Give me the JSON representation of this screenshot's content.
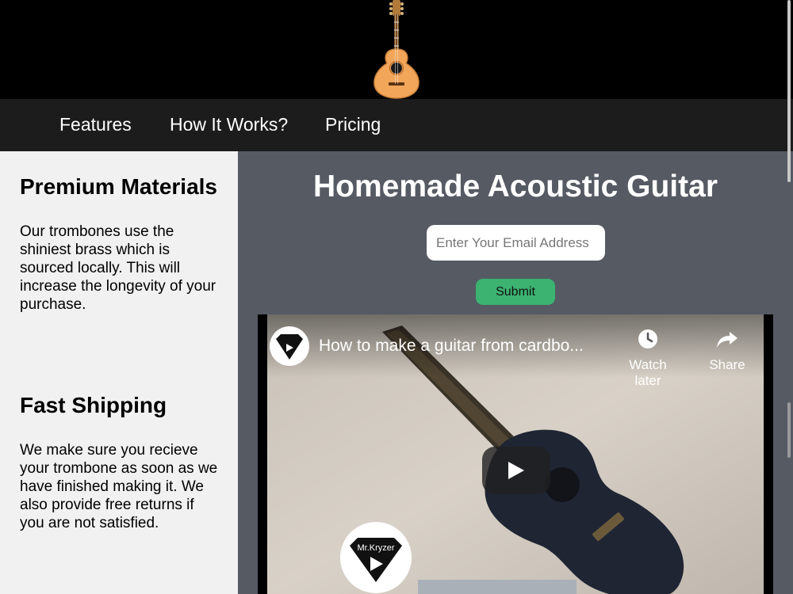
{
  "nav": {
    "features": "Features",
    "how_it_works": "How It Works?",
    "pricing": "Pricing"
  },
  "features": [
    {
      "title": "Premium Materials",
      "text": "Our trombones use the shiniest brass which is sourced locally. This will increase the longevity of your purchase."
    },
    {
      "title": "Fast Shipping",
      "text": "We make sure you recieve your trombone as soon as we have finished making it. We also provide free returns if you are not satisfied."
    }
  ],
  "main": {
    "title": "Homemade Acoustic Guitar",
    "email_placeholder": "Enter Your Email Address",
    "submit_label": "Submit"
  },
  "video": {
    "title": "How to make a guitar from cardbo...",
    "channel": "Mr.Kryzer",
    "watch_later": "Watch later",
    "share": "Share"
  },
  "colors": {
    "header_bg": "#000000",
    "nav_bg": "#1c1c1c",
    "sidebar_bg": "#f1f1f1",
    "main_bg": "#555a63",
    "submit_bg": "#3cb371"
  },
  "icons": [
    "guitar-logo-icon",
    "clock-icon",
    "share-arrow-icon",
    "play-icon",
    "diamond-logo-icon"
  ]
}
